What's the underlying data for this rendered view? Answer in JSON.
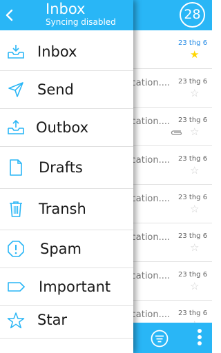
{
  "header": {
    "unread_count": "28"
  },
  "drawer": {
    "title": "Inbox",
    "subtitle": "Syncing disabled",
    "items": [
      {
        "label": "Inbox",
        "icon": "inbox-tray-icon"
      },
      {
        "label": "Send",
        "icon": "send-icon"
      },
      {
        "label": "Outbox",
        "icon": "outbox-tray-icon"
      },
      {
        "label": "Drafts",
        "icon": "document-icon"
      },
      {
        "label": "Transh",
        "icon": "trash-icon"
      },
      {
        "label": "Spam",
        "icon": "octagon-alert-icon"
      },
      {
        "label": "Important",
        "icon": "tag-icon"
      },
      {
        "label": "Star",
        "icon": "star-icon"
      }
    ]
  },
  "mail_list": {
    "rows": [
      {
        "snippet": "",
        "date": "23 thg 6",
        "starred": true,
        "attachment": false,
        "unread": true
      },
      {
        "snippet": "ication....",
        "date": "23 thg 6",
        "starred": false,
        "attachment": false,
        "unread": false
      },
      {
        "snippet": "ication....",
        "date": "23 thg 6",
        "starred": false,
        "attachment": true,
        "unread": false
      },
      {
        "snippet": "ication....",
        "date": "23 thg 6",
        "starred": false,
        "attachment": false,
        "unread": false
      },
      {
        "snippet": "ication....",
        "date": "23 thg 6",
        "starred": false,
        "attachment": false,
        "unread": false
      },
      {
        "snippet": "ication....",
        "date": "23 thg 6",
        "starred": false,
        "attachment": false,
        "unread": false
      },
      {
        "snippet": "ication....",
        "date": "23 thg 6",
        "starred": false,
        "attachment": false,
        "unread": false
      },
      {
        "snippet": "ication....",
        "date": "23 thg 6",
        "starred": false,
        "attachment": false,
        "unread": false
      }
    ]
  },
  "colors": {
    "accent": "#29b6f6",
    "star_active": "#ffd600",
    "date_new": "#1e88e5"
  }
}
